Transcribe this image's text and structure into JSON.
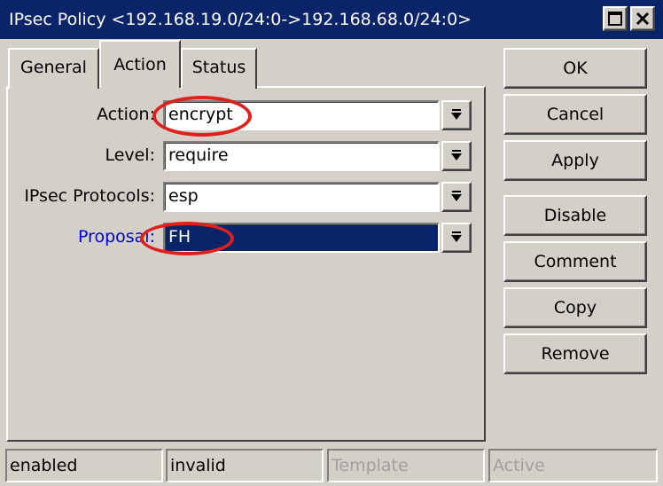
{
  "window": {
    "title": "IPsec Policy <192.168.19.0/24:0->192.168.68.0/24:0>",
    "titlebar_color": "#0a246a"
  },
  "tabs": [
    {
      "label": "General"
    },
    {
      "label": "Action",
      "active": true
    },
    {
      "label": "Status"
    }
  ],
  "form": {
    "action": {
      "label": "Action:",
      "value": "encrypt"
    },
    "level": {
      "label": "Level:",
      "value": "require"
    },
    "protocols": {
      "label": "IPsec Protocols:",
      "value": "esp"
    },
    "proposal": {
      "label": "Proposal:",
      "value": "FH",
      "label_color": "#0000d0"
    }
  },
  "buttons": {
    "ok": "OK",
    "cancel": "Cancel",
    "apply": "Apply",
    "disable": "Disable",
    "comment": "Comment",
    "copy": "Copy",
    "remove": "Remove"
  },
  "statusbar": {
    "enabled": "enabled",
    "invalid": "invalid",
    "template": "Template",
    "active": "Active"
  },
  "icons": {
    "maximize": "maximize-icon",
    "close": "close-icon",
    "dropdown": "dropdown-arrow-icon"
  },
  "annotation_color": "#e0201c"
}
